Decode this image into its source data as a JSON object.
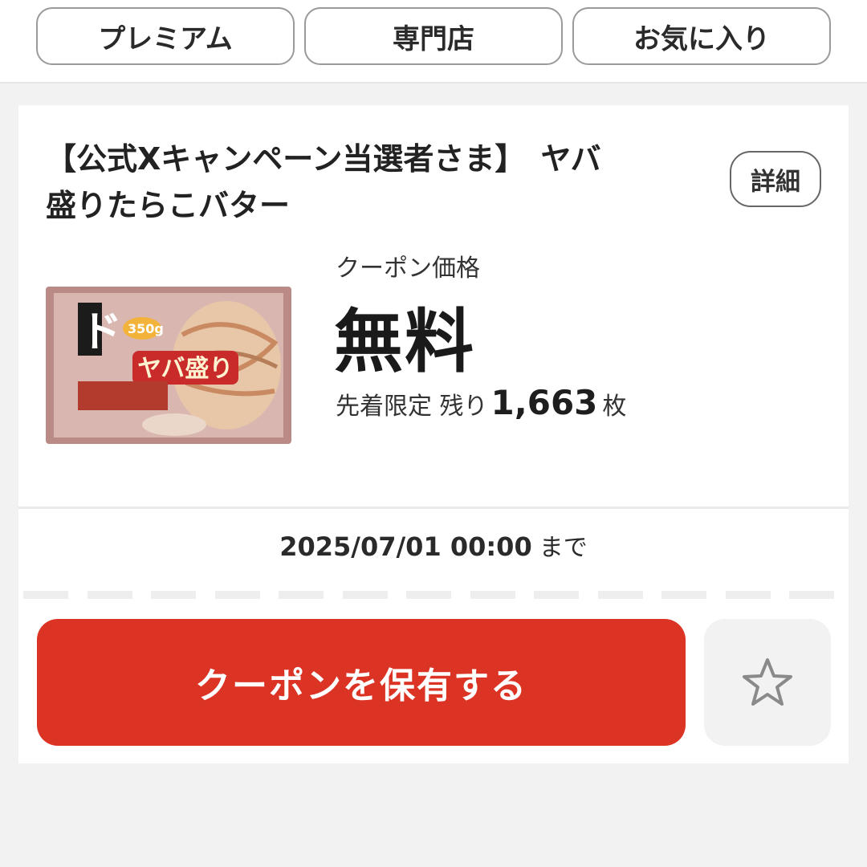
{
  "filters": [
    {
      "label": "プレミアム"
    },
    {
      "label": "専門店"
    },
    {
      "label": "お気に入り"
    }
  ],
  "coupon": {
    "title_line1": "【公式Xキャンペーン当選者さま】　ヤバ",
    "title_line2": "盛りたらこバター",
    "detail_label": "詳細",
    "product_image": {
      "brand_mark": "ド",
      "badge": "350g",
      "name_text": "ヤバ盛り"
    },
    "price_label": "クーポン価格",
    "price_value": "無料",
    "stock_prefix": "先着限定 残り",
    "stock_count": "1,663",
    "stock_unit": "枚",
    "expire_date": "2025/07/01 00:00",
    "expire_suffix": "まで",
    "cta_label": "クーポンを保有する",
    "favorite_icon": "star-outline-icon"
  },
  "colors": {
    "cta": "#db3324",
    "page_bg": "#f2f2f2",
    "card_bg": "#ffffff"
  }
}
